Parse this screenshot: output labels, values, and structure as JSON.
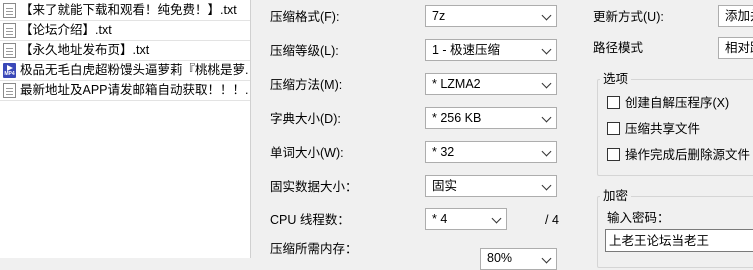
{
  "files": [
    {
      "icon": "text-file-icon",
      "name": "【来了就能下载和观看！纯免费！】.txt"
    },
    {
      "icon": "text-file-icon",
      "name": "【论坛介绍】.txt"
    },
    {
      "icon": "text-file-icon",
      "name": "【永久地址发布页】.txt"
    },
    {
      "icon": "video-file-icon",
      "icon_text": "MP4",
      "name": "极品无毛白虎超粉馒头逼萝莉『桃桃是萝..."
    },
    {
      "icon": "text-file-icon",
      "name": "最新地址及APP请发邮箱自动获取！！！...."
    }
  ],
  "settings": {
    "format": {
      "label": "压缩格式(F):",
      "value": "7z"
    },
    "level": {
      "label": "压缩等级(L):",
      "value": "1 - 极速压缩"
    },
    "method": {
      "label": "压缩方法(M):",
      "value": "* LZMA2"
    },
    "dict_size": {
      "label": "字典大小(D):",
      "value": "* 256 KB"
    },
    "word_size": {
      "label": "单词大小(W):",
      "value": "* 32"
    },
    "solid_size": {
      "label": "固实数据大小：",
      "value": "固实"
    },
    "cpu_threads": {
      "label": "CPU 线程数：",
      "value": "* 4",
      "suffix": "/ 4"
    },
    "memory": {
      "label": "压缩所需内存：",
      "value": "80%"
    }
  },
  "right": {
    "update_mode": {
      "label": "更新方式(U):",
      "value": "添加并"
    },
    "path_mode": {
      "label": "路径模式",
      "value": "相对路"
    },
    "options": {
      "title": "选项",
      "items": [
        {
          "label": "创建自解压程序(X)",
          "checked": false
        },
        {
          "label": "压缩共享文件",
          "checked": false
        },
        {
          "label": "操作完成后删除源文件",
          "checked": false
        }
      ]
    },
    "encryption": {
      "title": "加密",
      "password_label": "输入密码：",
      "password_value": "上老王论坛当老王"
    }
  }
}
